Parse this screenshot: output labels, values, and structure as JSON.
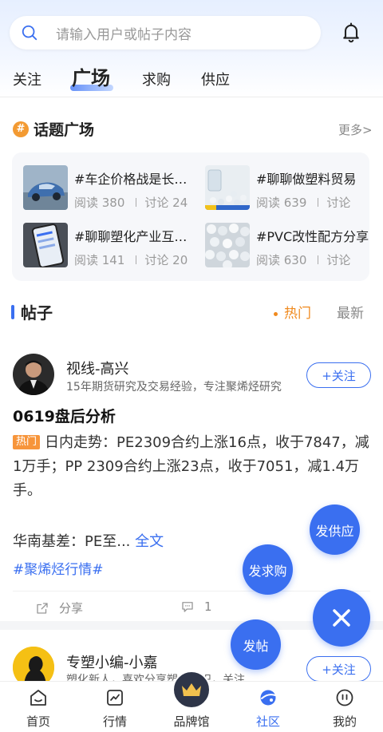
{
  "search": {
    "placeholder": "请输入用户或帖子内容"
  },
  "tabs": [
    {
      "label": "关注"
    },
    {
      "label": "广场"
    },
    {
      "label": "求购"
    },
    {
      "label": "供应"
    }
  ],
  "topics_section": {
    "icon": "hash-icon",
    "title": "话题广场",
    "more": "更多>",
    "items": [
      {
        "title": "#车企价格战是长久之计吗？",
        "read": "阅读 380",
        "discuss": "讨论 24",
        "thumb": "car-image"
      },
      {
        "title": "#聊聊做塑料贸易",
        "read": "阅读 639",
        "discuss": "讨论",
        "thumb": "plastic-pellets-image"
      },
      {
        "title": "#聊聊塑化产业互联网",
        "read": "阅读 141",
        "discuss": "讨论 20",
        "thumb": "phone-app-image"
      },
      {
        "title": "#PVC改性配方分享",
        "read": "阅读 630",
        "discuss": "讨论",
        "thumb": "white-pellets-image"
      }
    ]
  },
  "posts_section": {
    "title": "帖子",
    "sort_hot": "热门",
    "sort_latest": "最新"
  },
  "post1": {
    "author": "视线-高兴",
    "desc": "15年期货研究及交易经验，专注聚烯烃研究",
    "follow": "+关注",
    "title": "0619盘后分析",
    "hot_tag": "热门",
    "body": "日内走势：PE2309合约上涨16点，收于7847，减1万手；PP 2309合约上涨23点，收于7051，减1.4万手。",
    "body2": "华南基差：PE至...",
    "full_text": "全文",
    "topic_tag": "#聚烯烃行情#",
    "share": "分享",
    "comments": "1"
  },
  "post2": {
    "author": "专塑小编-小嘉",
    "desc": "塑化新人，喜欢分享塑化知识，关注...",
    "follow": "+关注"
  },
  "fabs": {
    "supply": "发供应",
    "purchase": "发求购",
    "post": "发帖"
  },
  "nav": [
    {
      "label": "首页",
      "icon": "home-icon"
    },
    {
      "label": "行情",
      "icon": "chart-icon"
    },
    {
      "label": "品牌馆",
      "icon": "crown-icon"
    },
    {
      "label": "社区",
      "icon": "community-icon"
    },
    {
      "label": "我的",
      "icon": "profile-icon"
    }
  ],
  "colors": {
    "accent": "#3a6ff0",
    "hot": "#f08a1e"
  }
}
